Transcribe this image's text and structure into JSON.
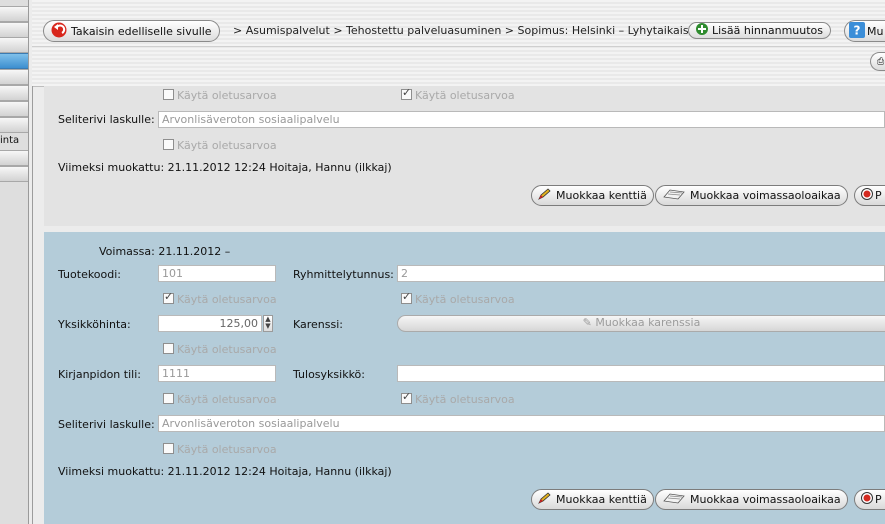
{
  "sidebar": {
    "partial_label": "inta"
  },
  "toolbar": {
    "back_label": "Takaisin edelliselle sivulle",
    "breadcrumb": "> Asumispalvelut > Tehostettu palveluasuminen > Sopimus: Helsinki – Lyhytaikaiset",
    "add_price_change_label": "Lisää hinnanmuutos",
    "help_partial_label": "Mu"
  },
  "panel1": {
    "default_checkbox_1": "Käytä oletusarvoa",
    "default_checkbox_2": "Käytä oletusarvoa",
    "invoice_line_label": "Seliterivi laskulle:",
    "invoice_line_value": "Arvonlisäveroton sosiaalipalvelu",
    "default_checkbox_3": "Käytä oletusarvoa",
    "last_modified": "Viimeksi muokattu: 21.11.2012 12:24  Hoitaja, Hannu (ilkkaj)",
    "edit_fields_label": "Muokkaa kenttiä",
    "edit_validity_label": "Muokkaa voimassaoloaikaa",
    "partial_button_label": "P"
  },
  "panel2": {
    "validity": "Voimassa: 21.11.2012 –",
    "product_code_label": "Tuotekoodi:",
    "product_code_value": "101",
    "group_id_label": "Ryhmittelytunnus:",
    "group_id_value": "2",
    "default_checkbox_1": "Käytä oletusarvoa",
    "default_checkbox_2": "Käytä oletusarvoa",
    "unit_price_label": "Yksikköhinta:",
    "unit_price_value": "125,00",
    "grace_label": "Karenssi:",
    "edit_grace_label": "Muokkaa karenssia",
    "default_checkbox_3": "Käytä oletusarvoa",
    "ledger_account_label": "Kirjanpidon tili:",
    "ledger_account_value": "1111",
    "result_unit_label": "Tulosyksikkö:",
    "result_unit_value": "",
    "default_checkbox_4": "Käytä oletusarvoa",
    "default_checkbox_5": "Käytä oletusarvoa",
    "invoice_line_label": "Seliterivi laskulle:",
    "invoice_line_value": "Arvonlisäveroton sosiaalipalvelu",
    "default_checkbox_6": "Käytä oletusarvoa",
    "last_modified": "Viimeksi muokattu: 21.11.2012 12:24  Hoitaja, Hannu (ilkkaj)",
    "edit_fields_label": "Muokkaa kenttiä",
    "edit_validity_label": "Muokkaa voimassaoloaikaa",
    "partial_button_label": "P"
  },
  "icons": {
    "back": "back-arrow-icon",
    "add": "plus-icon",
    "help": "help-icon",
    "edit": "pencil-icon",
    "validity": "calendar-icon",
    "remove": "stop-icon"
  },
  "colors": {
    "accent_blue": "#3d8fd0",
    "panel_blue": "#b4ccd9",
    "panel_gray": "#e3e3e3"
  }
}
